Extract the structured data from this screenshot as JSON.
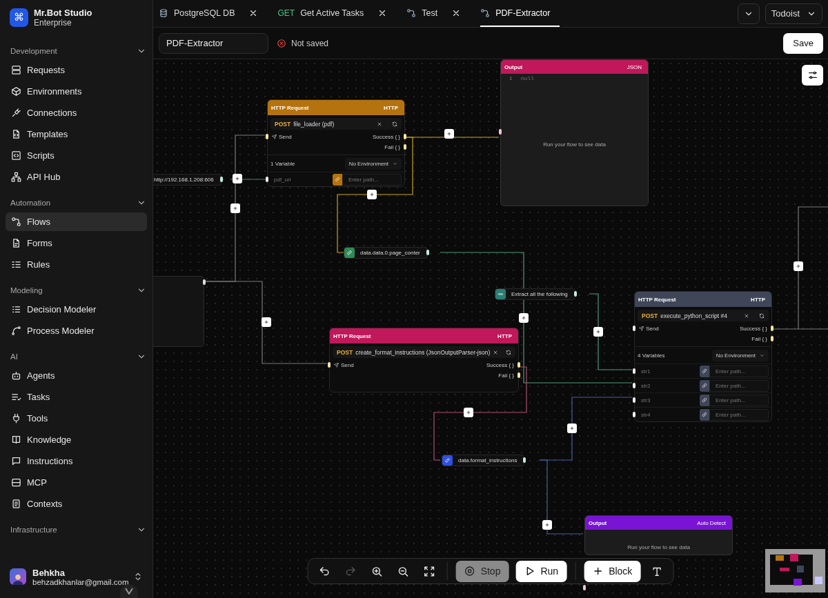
{
  "app": {
    "logo": "⌘",
    "name": "Mr.Bot Studio",
    "edition": "Enterprise"
  },
  "sidebar": {
    "sections": [
      {
        "title": "Development",
        "expanded": true,
        "items": [
          {
            "label": "Requests",
            "selected": false
          },
          {
            "label": "Environments",
            "selected": false
          },
          {
            "label": "Connections",
            "selected": false
          },
          {
            "label": "Templates",
            "selected": false
          },
          {
            "label": "Scripts",
            "selected": false
          },
          {
            "label": "API Hub",
            "selected": false
          }
        ]
      },
      {
        "title": "Automation",
        "expanded": true,
        "items": [
          {
            "label": "Flows",
            "selected": true
          },
          {
            "label": "Forms",
            "selected": false
          },
          {
            "label": "Rules",
            "selected": false
          }
        ]
      },
      {
        "title": "Modeling",
        "expanded": true,
        "items": [
          {
            "label": "Decision Modeler",
            "selected": false
          },
          {
            "label": "Process Modeler",
            "selected": false
          }
        ]
      },
      {
        "title": "AI",
        "expanded": true,
        "items": [
          {
            "label": "Agents",
            "selected": false
          },
          {
            "label": "Tasks",
            "selected": false
          },
          {
            "label": "Tools",
            "selected": false
          },
          {
            "label": "Knowledge",
            "selected": false
          },
          {
            "label": "Instructions",
            "selected": false
          },
          {
            "label": "MCP",
            "selected": false
          },
          {
            "label": "Contexts",
            "selected": false
          }
        ]
      },
      {
        "title": "Infrastructure",
        "expanded": true
      }
    ]
  },
  "user": {
    "name": "Behkha",
    "email": "behzadkhanlar@gmail.com"
  },
  "tabs": [
    {
      "kind": "database",
      "label": "PostgreSQL DB",
      "selected": false
    },
    {
      "kind": "request",
      "method": "GET",
      "label": "Get Active Tasks",
      "selected": false
    },
    {
      "kind": "flow",
      "label": "Test",
      "selected": false
    },
    {
      "kind": "flow",
      "label": "PDF-Extractor",
      "selected": true
    }
  ],
  "workspace": {
    "label": "Todoist"
  },
  "flow": {
    "name": "PDF-Extractor",
    "saved": false,
    "status": "Not saved",
    "save": "Save"
  },
  "canvas": {
    "requests": [
      {
        "title": "HTTP Request",
        "badge": "HTTP",
        "color": "#b5730f",
        "method": "POST",
        "name": "file_loader (pdf)",
        "send": "Send",
        "success": "Success { }",
        "fail": "Fail { }",
        "variables_label": "1 Variable",
        "environment": "No Environment",
        "variables": [
          {
            "name": "pdf_url",
            "placeholder": "Enter path..."
          }
        ]
      },
      {
        "title": "HTTP Request",
        "badge": "HTTP",
        "color": "#c0185a",
        "method": "POST",
        "name": "create_format_instructions (JsonOutputParser-json)",
        "send": "Send",
        "success": "Success { }",
        "fail": "Fail { }"
      },
      {
        "title": "HTTP Request",
        "badge": "HTTP",
        "color": "#3f4658",
        "method": "POST",
        "name": "execute_python_script #4",
        "send": "Send",
        "success": "Success { }",
        "fail": "Fail { }",
        "variables_label": "4 Variables",
        "environment": "No Environment",
        "variables": [
          {
            "name": "str1",
            "placeholder": "Enter path..."
          },
          {
            "name": "str2",
            "placeholder": "Enter path..."
          },
          {
            "name": "str3",
            "placeholder": "Enter path..."
          },
          {
            "name": "str4",
            "placeholder": "Enter path..."
          }
        ]
      }
    ],
    "outputs": [
      {
        "title": "Output",
        "badge": "JSON",
        "color": "#c0185a",
        "lines": [
          {
            "number": "1",
            "code": "null"
          }
        ],
        "message": "Run your flow to see data"
      },
      {
        "title": "Output",
        "badge": "Auto Detect",
        "color": "#7a14d4",
        "message": "Run your flow to see data"
      }
    ],
    "values": [
      {
        "kind": "plain",
        "text": "http://192.168.1.208:606"
      },
      {
        "kind": "path",
        "color": "#2e8b57",
        "text": "data.data.0.page_conter"
      },
      {
        "kind": "text",
        "color": "#2a7f74",
        "text": "Extract all the following"
      },
      {
        "kind": "path",
        "color": "#2f4fe0",
        "text": "data.format_instructions"
      }
    ]
  },
  "toolbar": {
    "tools": [
      {
        "kind": "undo",
        "disabled": false
      },
      {
        "kind": "redo",
        "disabled": true
      },
      {
        "kind": "zoom_in",
        "disabled": false
      },
      {
        "kind": "zoom_out",
        "disabled": false
      },
      {
        "kind": "fit",
        "disabled": false
      }
    ],
    "actions": [
      {
        "kind": "stop",
        "label": "Stop",
        "disabled": true
      },
      {
        "kind": "run",
        "label": "Run",
        "disabled": false
      },
      {
        "kind": "add",
        "label": "Block",
        "disabled": false
      }
    ],
    "end_tools": [
      {
        "kind": "text",
        "disabled": false
      }
    ]
  }
}
